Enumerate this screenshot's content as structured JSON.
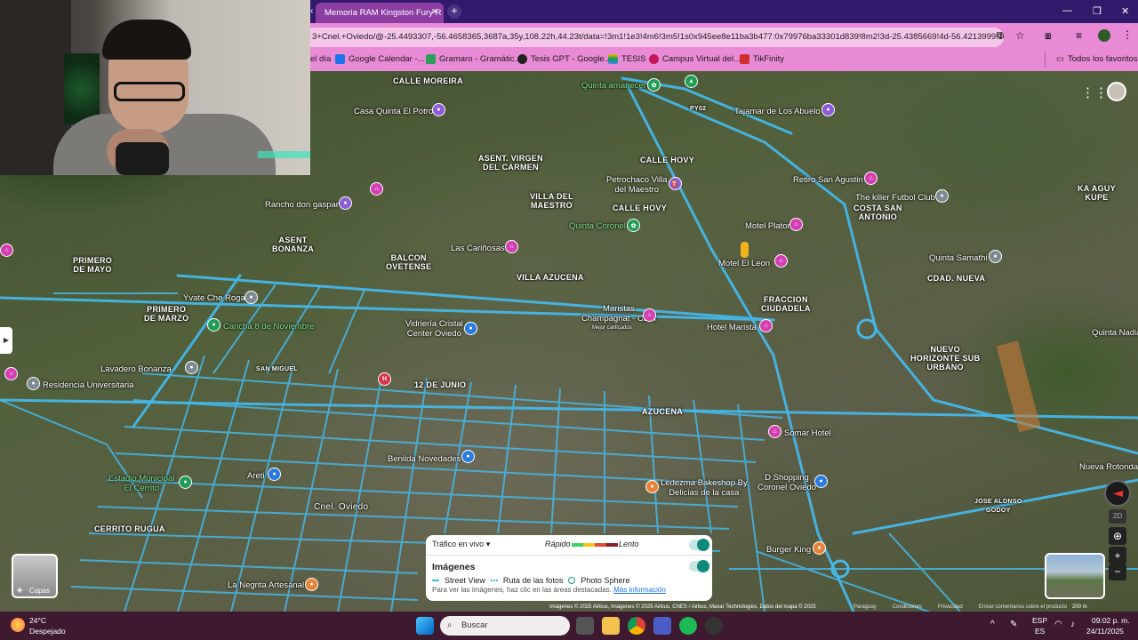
{
  "browser": {
    "tab_title": "Memoria RAM Kingston Fury R",
    "url": "3+Cnel.+Oviedo/@-25.4493307,-56.4658365,3687a,35y,108.22h,44.23t/data=!3m1!1e3!4m6!3m5!1s0x945ee8e11ba3b477:0x79976ba33301d839!8m2!3d-25.4385669!4d-56.4213999!16s...",
    "bookmarks": [
      "el día",
      "Google Calendar -...",
      "Gramaro - Gramátic...",
      "Tesis GPT - Google...",
      "TESIS",
      "Campus Virtual del...",
      "TikFinity"
    ],
    "all_bookmarks": "Todos los favoritos"
  },
  "map": {
    "areas": [
      "CALLE MOREIRA",
      "ASENT. VIRGEN\nDEL CARMEN",
      "CALLE HOVY",
      "VILLA DEL\nMAESTRO",
      "CALLE HOVY",
      "ASENT\nBONANZA",
      "BALCON\nOVETENSE",
      "PRIMERO\nDE MAYO",
      "PRIMERO\nDE MARZO",
      "VILLA AZUCENA",
      "FRACCION\nCIUDADELA",
      "COSTA SAN\nANTONIO",
      "CDAD. NUEVA",
      "KA AGUY\nKUPE",
      "NUEVO\nHORIZONTE SUB\nURBANO",
      "AZUCENA",
      "12 DE JUNIO",
      "SAN MIGUEL",
      "CERRITO RUGUA",
      "Cnel. Oviedo",
      "JOSE ALONSO\nGODOY",
      "PY02"
    ],
    "pois": [
      "Quinta amanecer",
      "Tajamar de Los Abuelo",
      "Casa Quinta El Potro",
      "Petrochaco Villa\ndel Maestro",
      "Retiro San Agustin",
      "The killer Futbol Club",
      "Rancho don gaspar",
      "Quinta Coronel",
      "Motel Platon",
      "Las Cariñosas",
      "Motel El Leon",
      "Quinta Samathi",
      "Ývate Che Roga",
      "Maristas\nChampagnat - CEM",
      "Hotel Marista",
      "Cancha 8 de Noviembre",
      "Vidriería Cristal\nCenter Oviedo",
      "Lavadero Bonanza",
      "Residencia Universitaria",
      "Somar Hotel",
      "Benilda Novedades",
      "Estadio Municipal\nEl Cerrito",
      "Areti",
      "Ledezma Bakeshop By\nDelicias de la casa",
      "D Shopping\nCoronel Oviedo",
      "Burger King",
      "La Negrita Artesanal",
      "Nueva Rotonda",
      "Quinta Nadia"
    ],
    "subpoi": "Mejor calificados",
    "layers_label": "Capas",
    "attribution": "Imágenes © 2025 Airbus, Imágenes © 2025 Airbus, CNES / Airbus, Maxar Technologies, Datos del mapa © 2025",
    "attr_links": [
      "Paraguay",
      "Condiciones",
      "Privacidad",
      "Enviar comentarios sobre el producto"
    ],
    "scale": "200 m",
    "btn_2d": "2D"
  },
  "legend": {
    "traffic": "Tráfico en vivo",
    "fast": "Rápido",
    "slow": "Lento",
    "images": "Imágenes",
    "street_view": "Street View",
    "photo_route": "Ruta de las fotos",
    "photo_sphere": "Photo Sphere",
    "hint": "Para ver las imágenes, haz clic en las áreas destacadas.",
    "more": "Más información"
  },
  "taskbar": {
    "temp": "24°C",
    "weather": "Despejado",
    "search": "Buscar",
    "lang1": "ESP",
    "lang2": "ES",
    "time": "09:02 p. m.",
    "date": "24/11/2025"
  },
  "colors": {
    "road": "#45b7e8",
    "tab_bar": "#311a6b",
    "chrome_pink": "#e98ad6",
    "taskbar": "#3d1a2f"
  }
}
